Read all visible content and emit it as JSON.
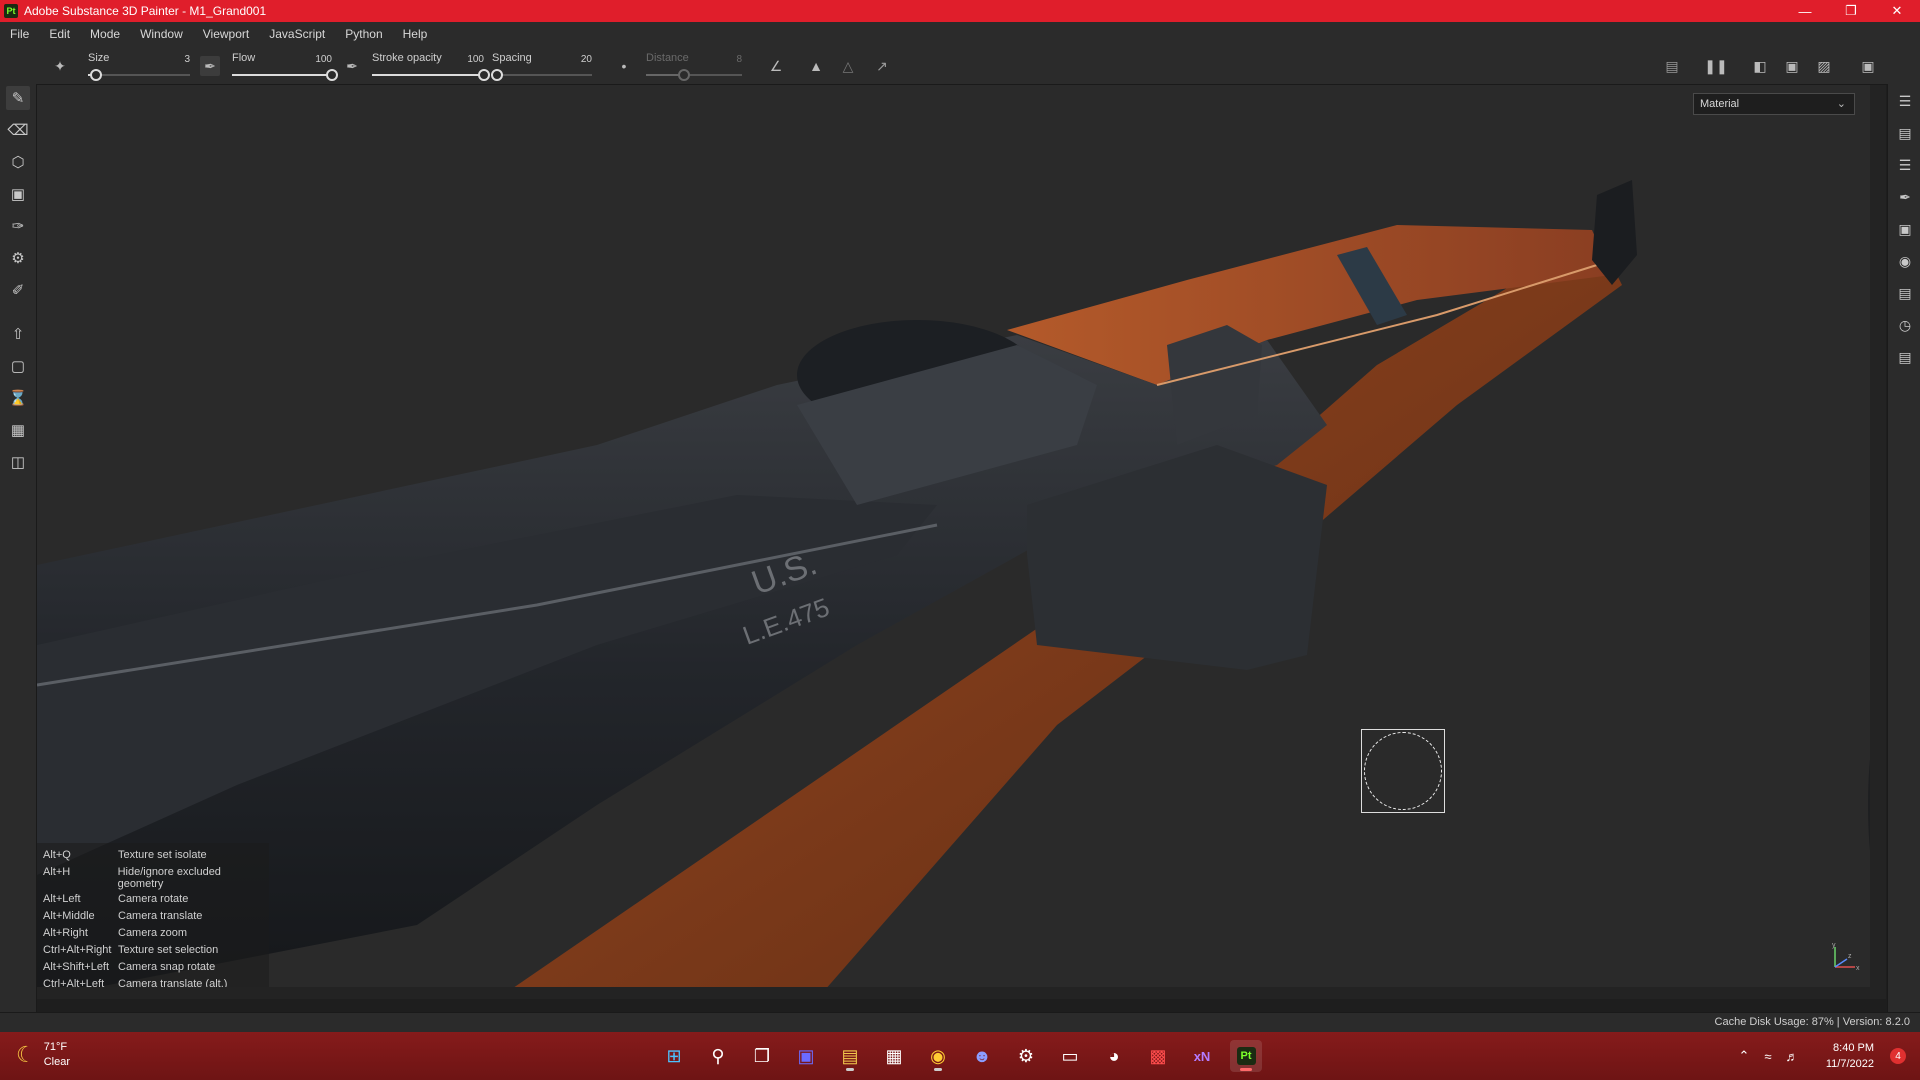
{
  "window": {
    "app_icon": "Pt",
    "title": "Adobe Substance 3D Painter - M1_Grand001",
    "controls": [
      "minimize-icon",
      "restore-icon",
      "close-icon"
    ]
  },
  "menu": [
    "File",
    "Edit",
    "Mode",
    "Window",
    "Viewport",
    "JavaScript",
    "Python",
    "Help"
  ],
  "toolbar": {
    "size": {
      "label": "Size",
      "value": "3",
      "level": 0.08
    },
    "flow": {
      "label": "Flow",
      "value": "100",
      "level": 1.0
    },
    "stroke_opacity": {
      "label": "Stroke opacity",
      "value": "100",
      "level": 1.0
    },
    "spacing": {
      "label": "Spacing",
      "value": "20",
      "level": 0.05
    },
    "distance": {
      "label": "Distance",
      "value": "8",
      "level": 0.4
    }
  },
  "viewport": {
    "mode_dropdown": "Material",
    "axis_labels": {
      "x": "x",
      "y": "y",
      "z": "z"
    },
    "shortcuts": [
      {
        "key": "Alt+Q",
        "action": "Texture set isolate"
      },
      {
        "key": "Alt+H",
        "action": "Hide/ignore excluded geometry"
      },
      {
        "key": "Alt+Left",
        "action": "Camera rotate"
      },
      {
        "key": "Alt+Middle",
        "action": "Camera translate"
      },
      {
        "key": "Alt+Right",
        "action": "Camera zoom"
      },
      {
        "key": "Ctrl+Alt+Right",
        "action": "Texture set selection"
      },
      {
        "key": "Alt+Shift+Left",
        "action": "Camera snap rotate"
      },
      {
        "key": "Ctrl+Alt+Left",
        "action": "Camera translate (alt.)"
      }
    ],
    "engraving_line1": "U.S.",
    "engraving_line2": "L.E.475"
  },
  "status": {
    "text": "Cache Disk Usage:   87% | Version: 8.2.0"
  },
  "taskbar": {
    "weather_temp": "71°F",
    "weather_desc": "Clear",
    "time": "8:40 PM",
    "date": "11/7/2022",
    "notifications": "4",
    "xn_label": "xN",
    "pt_label": "Pt"
  }
}
